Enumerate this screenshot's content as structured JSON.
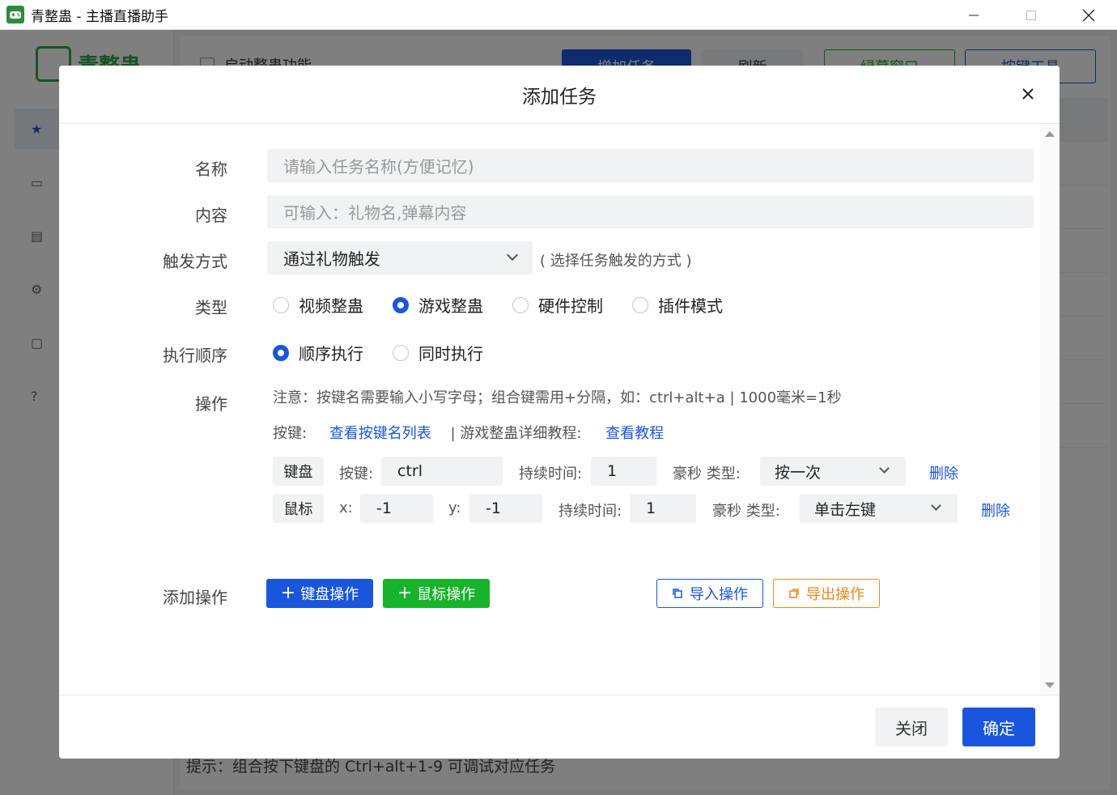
{
  "window": {
    "title": "青整蛊 - 主播直播助手"
  },
  "background": {
    "logo_text": "青整蛊",
    "auto_feature_label": "启动整蛊功能",
    "add_task_button": "增加任务",
    "refresh_button": "刷新",
    "record_button": "绿幕窗口",
    "key_tool_button": "按键工具",
    "tip": "提示：组合按下键盘的 Ctrl+alt+1-9 可调试对应任务"
  },
  "modal": {
    "title": "添加任务",
    "name": {
      "label": "名称",
      "placeholder": "请输入任务名称(方便记忆)"
    },
    "content": {
      "label": "内容",
      "placeholder": "可输入：礼物名,弹幕内容"
    },
    "trigger": {
      "label": "触发方式",
      "value": "通过礼物触发",
      "hint": "( 选择任务触发的方式 )"
    },
    "type": {
      "label": "类型",
      "options": [
        "视频整蛊",
        "游戏整蛊",
        "硬件控制",
        "插件模式"
      ],
      "selected_index": 1
    },
    "order": {
      "label": "执行顺序",
      "options": [
        "顺序执行",
        "同时执行"
      ],
      "selected_index": 0
    },
    "operation": {
      "label": "操作",
      "note": "注意：按键名需要输入小写字母；组合键需用+分隔，如：ctrl+alt+a | 1000毫米=1秒",
      "keys_label": "按键:",
      "keys_link": "查看按键名列表",
      "tutorial_label": "| 游戏整蛊详细教程:",
      "tutorial_link": "查看教程",
      "rows": [
        {
          "tag": "键盘",
          "key_label": "按键:",
          "key_value": "ctrl",
          "duration_label": "持续时间:",
          "duration_value": "1",
          "type_label": "豪秒 类型:",
          "type_value": "按一次",
          "delete": "删除"
        },
        {
          "tag": "鼠标",
          "x_label": "x:",
          "x_value": "-1",
          "y_label": "y:",
          "y_value": "-1",
          "duration_label": "持续时间:",
          "duration_value": "1",
          "type_label": "豪秒 类型:",
          "type_value": "单击左键",
          "delete": "删除"
        }
      ]
    },
    "add_operation": {
      "label": "添加操作",
      "keyboard_button": "键盘操作",
      "mouse_button": "鼠标操作",
      "import_button": "导入操作",
      "export_button": "导出操作"
    },
    "footer": {
      "close_button": "关闭",
      "confirm_button": "确定"
    }
  },
  "colors": {
    "primary": "#1a56db",
    "green": "#17b32b",
    "orange": "#e8891b"
  }
}
